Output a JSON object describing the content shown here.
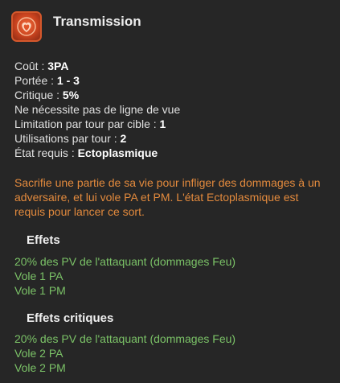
{
  "spell": {
    "title": "Transmission",
    "icon": "flame-heart-icon"
  },
  "stats": [
    {
      "label": "Coût : ",
      "value": "3PA"
    },
    {
      "label": "Portée : ",
      "value": "1 - 3"
    },
    {
      "label": "Critique : ",
      "value": "5%"
    },
    {
      "label": "Ne nécessite pas de ligne de vue",
      "value": ""
    },
    {
      "label": "Limitation par tour par cible : ",
      "value": "1"
    },
    {
      "label": "Utilisations par tour : ",
      "value": "2"
    },
    {
      "label": "État requis : ",
      "value": "Ectoplasmique"
    }
  ],
  "description": "Sacrifie une partie de sa vie pour infliger des dommages à un adversaire, et lui vole PA et PM. L'état Ectoplasmique est requis pour lancer ce sort.",
  "effects": {
    "title": "Effets",
    "lines": [
      "20% des PV de l'attaquant (dommages Feu)",
      "Vole 1 PA",
      "Vole 1 PM"
    ]
  },
  "critical_effects": {
    "title": "Effets critiques",
    "lines": [
      "20% des PV de l'attaquant (dommages Feu)",
      "Vole 2 PA",
      "Vole 2 PM"
    ]
  },
  "colors": {
    "background": "#262626",
    "description": "#e38a3d",
    "effect": "#7bc267",
    "icon_accent": "#d4582c"
  }
}
